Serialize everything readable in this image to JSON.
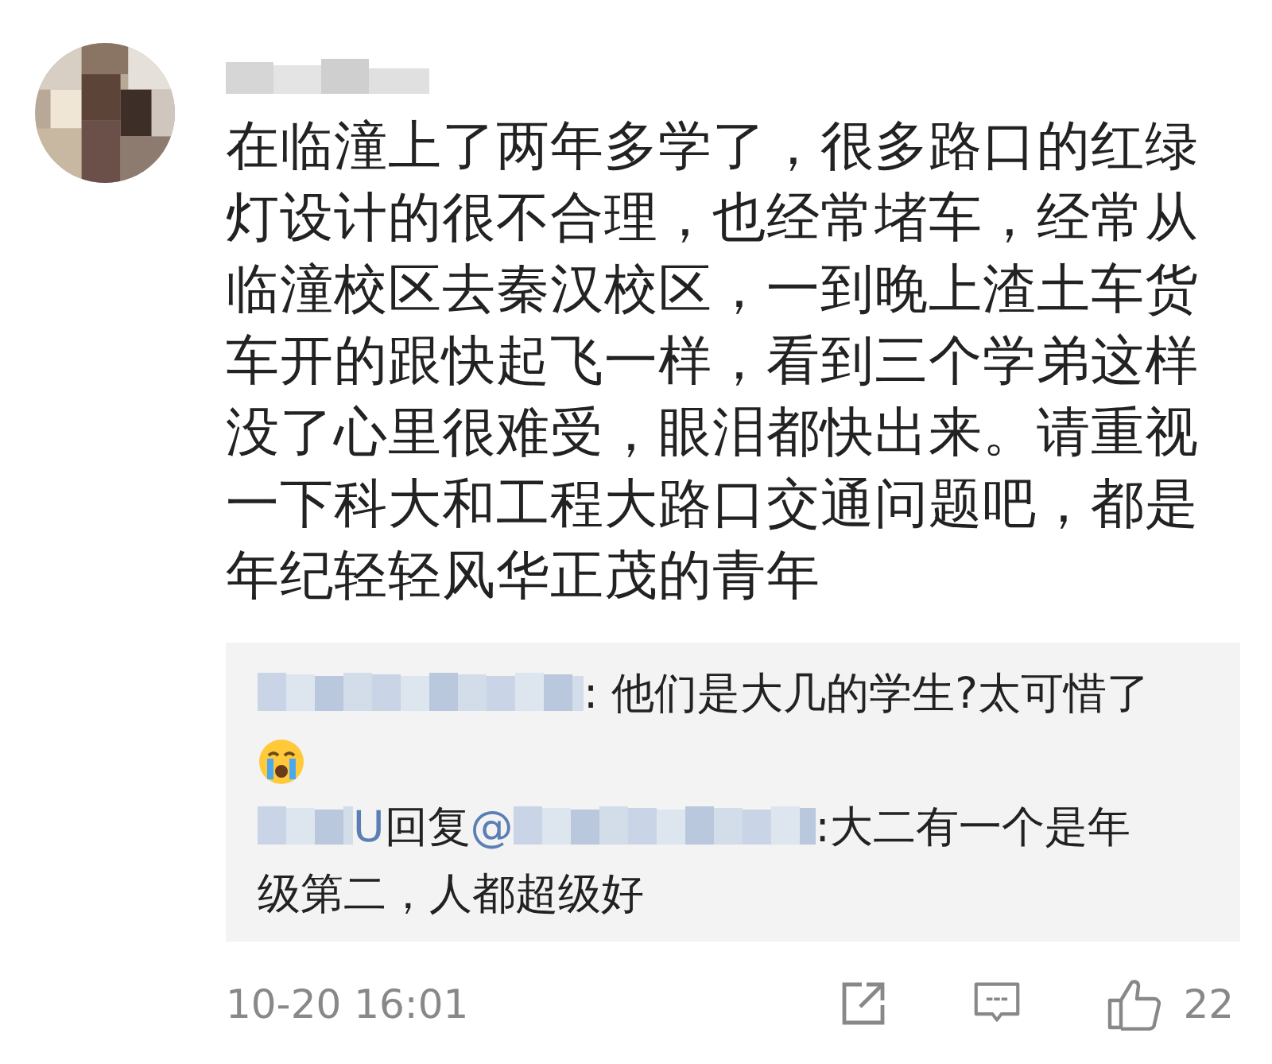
{
  "comment": {
    "text": "在临潼上了两年多学了，很多路口的红绿灯设计的很不合理，也经常堵车，经常从临潼校区去秦汉校区，一到晚上渣土车货车开的跟快起飞一样，看到三个学弟这样没了心里很难受，眼泪都快出来。请重视一下科大和工程大路口交通问题吧，都是年纪轻轻风华正茂的青年",
    "replies": [
      {
        "kind": "comment",
        "lines": [
          ": 他们是大几的学生?太可惜了"
        ],
        "emoji": true
      },
      {
        "kind": "reply",
        "tail": "U",
        "reply_label": "回复",
        "mention_mark": "@",
        "lines": [
          ":大二有一个是年",
          "级第二，人都超级好"
        ],
        "emoji": false
      }
    ],
    "time": "10-20 16:01",
    "likes": "22"
  }
}
